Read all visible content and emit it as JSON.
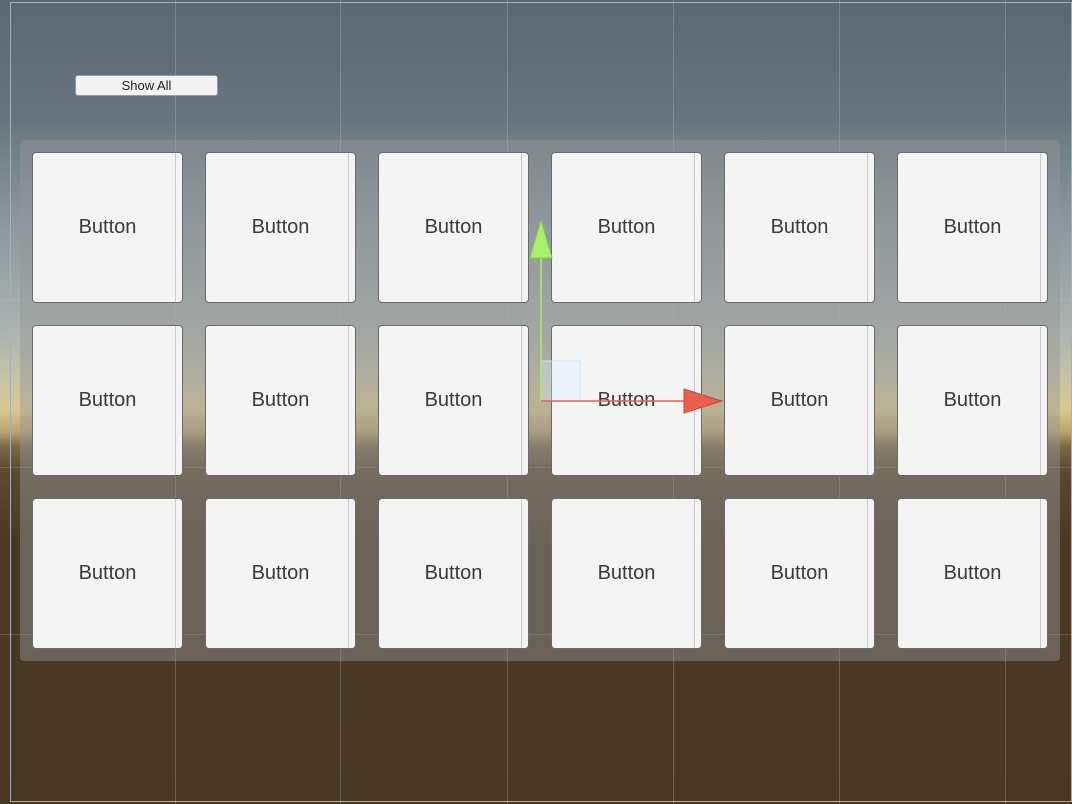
{
  "toolbar": {
    "show_all_label": "Show All"
  },
  "grid": {
    "buttons": [
      {
        "label": "Button"
      },
      {
        "label": "Button"
      },
      {
        "label": "Button"
      },
      {
        "label": "Button"
      },
      {
        "label": "Button"
      },
      {
        "label": "Button"
      },
      {
        "label": "Button"
      },
      {
        "label": "Button"
      },
      {
        "label": "Button"
      },
      {
        "label": "Button"
      },
      {
        "label": "Button"
      },
      {
        "label": "Button"
      },
      {
        "label": "Button"
      },
      {
        "label": "Button"
      },
      {
        "label": "Button"
      },
      {
        "label": "Button"
      },
      {
        "label": "Button"
      },
      {
        "label": "Button"
      }
    ]
  },
  "gizmo": {
    "icons": [
      "y-axis-arrow-icon",
      "x-axis-arrow-icon",
      "xy-plane-handle-icon"
    ],
    "colors": {
      "y_axis": "#a9f06a",
      "x_axis": "#e8604a",
      "plane": "#bfe3ff"
    }
  }
}
